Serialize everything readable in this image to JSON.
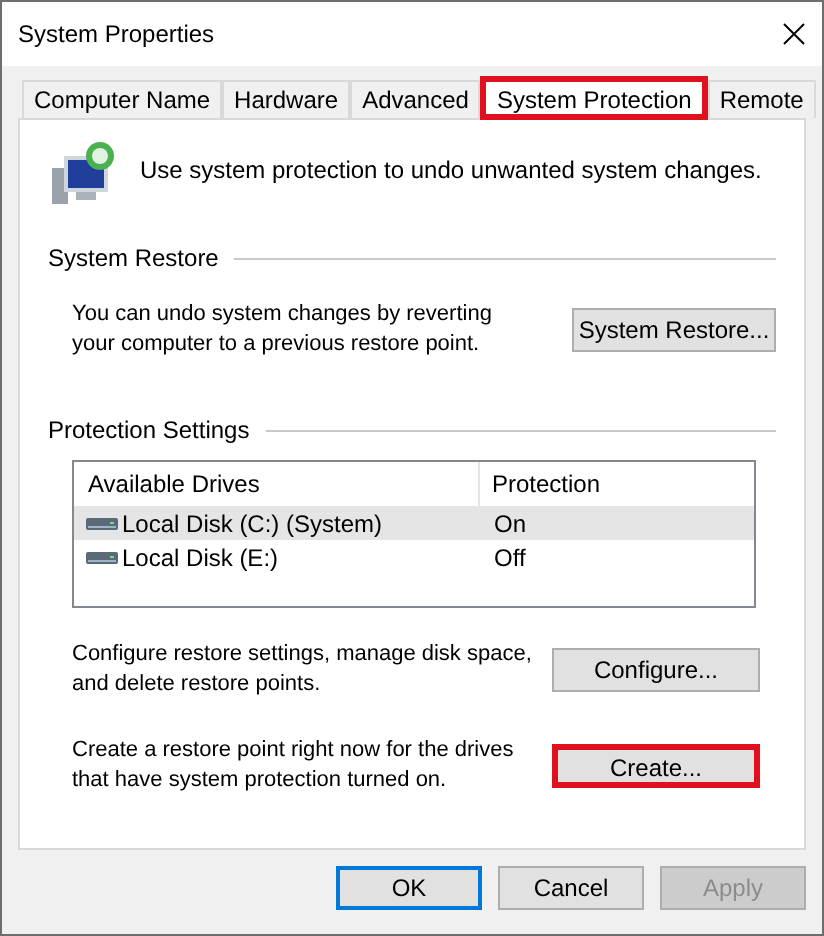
{
  "window": {
    "title": "System Properties"
  },
  "tabs": [
    {
      "label": "Computer Name",
      "selected": false,
      "highlighted": false
    },
    {
      "label": "Hardware",
      "selected": false,
      "highlighted": false
    },
    {
      "label": "Advanced",
      "selected": false,
      "highlighted": false
    },
    {
      "label": "System Protection",
      "selected": true,
      "highlighted": true
    },
    {
      "label": "Remote",
      "selected": false,
      "highlighted": false
    }
  ],
  "intro": "Use system protection to undo unwanted system changes.",
  "system_restore": {
    "heading": "System Restore",
    "text": "You can undo system changes by reverting your computer to a previous restore point.",
    "button": {
      "label": "System Restore...",
      "highlighted": false
    }
  },
  "protection_settings": {
    "heading": "Protection Settings",
    "columns": [
      "Available Drives",
      "Protection"
    ],
    "rows": [
      {
        "drive": "Local Disk (C:) (System)",
        "protection": "On",
        "selected": true
      },
      {
        "drive": "Local Disk (E:)",
        "protection": "Off",
        "selected": false
      }
    ],
    "actions": [
      {
        "text": "Configure restore settings, manage disk space, and delete restore points.",
        "button": {
          "label": "Configure...",
          "highlighted": false
        }
      },
      {
        "text": "Create a restore point right now for the drives that have system protection turned on.",
        "button": {
          "label": "Create...",
          "highlighted": true
        }
      }
    ]
  },
  "buttons": [
    {
      "label": "OK",
      "default": true,
      "disabled": false
    },
    {
      "label": "Cancel",
      "default": false,
      "disabled": false
    },
    {
      "label": "Apply",
      "default": false,
      "disabled": true
    }
  ]
}
